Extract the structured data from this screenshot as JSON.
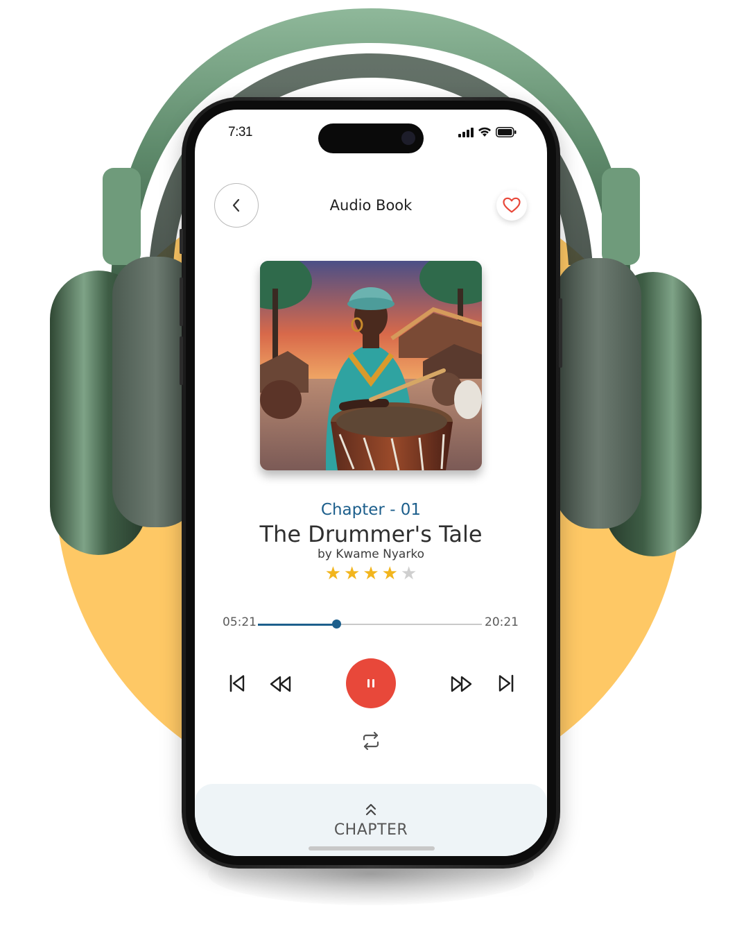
{
  "status_bar": {
    "time": "7:31",
    "icons": [
      "signal-icon",
      "wifi-icon",
      "battery-icon"
    ]
  },
  "header": {
    "title": "Audio Book",
    "back_icon": "chevron-left-icon",
    "favorite_icon": "heart-icon"
  },
  "book": {
    "chapter": "Chapter - 01",
    "title": "The Drummer's Tale",
    "author": "by Kwame Nyarko",
    "rating": 4,
    "rating_max": 5
  },
  "player": {
    "current_time": "05:21",
    "total_time": "20:21",
    "progress": 0.35,
    "state": "playing"
  },
  "controls": [
    "skip-previous-icon",
    "rewind-icon",
    "pause-icon",
    "fast-forward-icon",
    "skip-next-icon",
    "repeat-icon"
  ],
  "bottom_sheet": {
    "label": "CHAPTER",
    "icon": "double-chevron-up-icon"
  },
  "colors": {
    "accent_blue": "#1d5f8c",
    "play_red": "#e8483a",
    "heart_red": "#e8483a",
    "star_gold": "#f2b51d",
    "star_empty": "#cfcfcf",
    "backdrop_yellow": "#fec865",
    "headphone_green": "#5e8a6b"
  }
}
